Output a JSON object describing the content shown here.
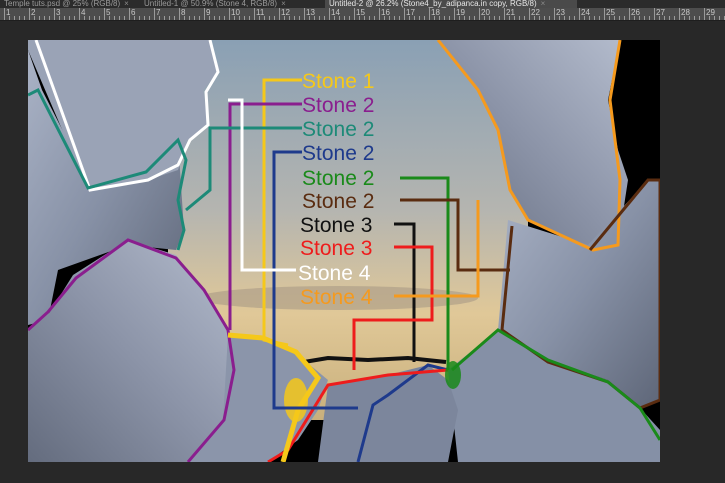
{
  "tabs": [
    {
      "label": "Temple tuts.psd @ 25% (RGB/8)",
      "close": "×"
    },
    {
      "label": "Untitled-1 @ 50.9% (Stone 4, RGB/8)",
      "close": "×"
    },
    {
      "label": "Untitled-2 @ 26.2% (Stone4_by_adipanca.in copy, RGB/8)",
      "close": "×"
    }
  ],
  "ruler": {
    "numbers": [
      "1",
      "2",
      "3",
      "4",
      "5",
      "6",
      "7",
      "8",
      "9",
      "10",
      "11",
      "12",
      "13",
      "14",
      "15",
      "16",
      "17",
      "18",
      "19",
      "20",
      "21",
      "22",
      "23",
      "24",
      "25",
      "26",
      "27",
      "28",
      "29"
    ]
  },
  "labels": [
    {
      "text": "Stone 1",
      "color": "#f5c81a"
    },
    {
      "text": "Stone 2",
      "color": "#8a1e8e"
    },
    {
      "text": "Stone 2",
      "color": "#1d8a78"
    },
    {
      "text": "Stone 2",
      "color": "#1e3a8c"
    },
    {
      "text": "Stone 2",
      "color": "#1a8a1a"
    },
    {
      "text": "Stone 2",
      "color": "#5a2c10"
    },
    {
      "text": "Stone 3",
      "color": "#111111"
    },
    {
      "text": "Stone 3",
      "color": "#ee1c1c"
    },
    {
      "text": "Stone 4",
      "color": "#ffffff"
    },
    {
      "text": "Stone 4",
      "color": "#f59a1e"
    }
  ]
}
